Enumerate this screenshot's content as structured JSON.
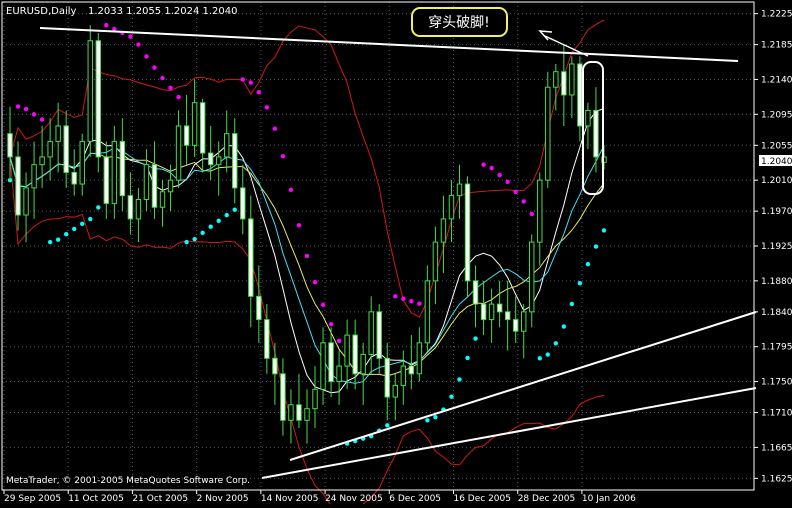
{
  "header": {
    "symbol": "EURUSD,Daily",
    "ohlc": "1.2033 1.2055 1.2024 1.2040"
  },
  "annotation": {
    "text": "穿头破脚!"
  },
  "copyright": "MetaTrader, © 2001-2005 MetaQuotes Software Corp.",
  "price_marker": "1.2040",
  "colors": {
    "background": "#000000",
    "grid": "#4a5a6a",
    "axis_text": "#ffffff",
    "candle_bull_fill": "#000000",
    "candle_bear_fill": "#ffffff",
    "candle_outline": "#44dd44",
    "bollinger": "#d01818",
    "ma_fast": "#ffffff",
    "ma_slow": "#e8e86a",
    "ma_cyan": "#40e0f0",
    "sar_magenta": "#ff00ff",
    "sar_cyan": "#00ffff",
    "callout_border": "#f0f060"
  },
  "chart_data": {
    "type": "candlestick",
    "title": "EURUSD,Daily",
    "ylim": [
      1.161,
      1.224
    ],
    "y_ticks": [
      "1.2225",
      "1.2185",
      "1.2140",
      "1.2095",
      "1.2055",
      "1.2010",
      "1.1970",
      "1.1925",
      "1.1880",
      "1.1840",
      "1.1795",
      "1.1750",
      "1.1710",
      "1.1665",
      "1.1625"
    ],
    "x_ticks": [
      "29 Sep 2005",
      "11 Oct 2005",
      "21 Oct 2005",
      "2 Nov 2005",
      "14 Nov 2005",
      "24 Nov 2005",
      "6 Dec 2005",
      "16 Dec 2005",
      "28 Dec 2005",
      "10 Jan 2006"
    ],
    "candles": [
      {
        "o": 1.207,
        "h": 1.2105,
        "l": 1.201,
        "c": 1.204
      },
      {
        "o": 1.204,
        "h": 1.206,
        "l": 1.1945,
        "c": 1.1965
      },
      {
        "o": 1.1965,
        "h": 1.202,
        "l": 1.193,
        "c": 1.2
      },
      {
        "o": 1.2,
        "h": 1.206,
        "l": 1.196,
        "c": 1.203
      },
      {
        "o": 1.203,
        "h": 1.208,
        "l": 1.2,
        "c": 1.204
      },
      {
        "o": 1.204,
        "h": 1.209,
        "l": 1.201,
        "c": 1.206
      },
      {
        "o": 1.206,
        "h": 1.211,
        "l": 1.202,
        "c": 1.208
      },
      {
        "o": 1.208,
        "h": 1.21,
        "l": 1.2,
        "c": 1.202
      },
      {
        "o": 1.202,
        "h": 1.205,
        "l": 1.199,
        "c": 1.2005
      },
      {
        "o": 1.2005,
        "h": 1.207,
        "l": 1.199,
        "c": 1.206
      },
      {
        "o": 1.206,
        "h": 1.221,
        "l": 1.204,
        "c": 1.219
      },
      {
        "o": 1.219,
        "h": 1.22,
        "l": 1.202,
        "c": 1.204
      },
      {
        "o": 1.204,
        "h": 1.206,
        "l": 1.196,
        "c": 1.198
      },
      {
        "o": 1.198,
        "h": 1.208,
        "l": 1.196,
        "c": 1.206
      },
      {
        "o": 1.206,
        "h": 1.209,
        "l": 1.197,
        "c": 1.199
      },
      {
        "o": 1.199,
        "h": 1.202,
        "l": 1.194,
        "c": 1.196
      },
      {
        "o": 1.196,
        "h": 1.2,
        "l": 1.193,
        "c": 1.1985
      },
      {
        "o": 1.1985,
        "h": 1.205,
        "l": 1.197,
        "c": 1.203
      },
      {
        "o": 1.203,
        "h": 1.206,
        "l": 1.196,
        "c": 1.1975
      },
      {
        "o": 1.1975,
        "h": 1.201,
        "l": 1.195,
        "c": 1.1995
      },
      {
        "o": 1.1995,
        "h": 1.203,
        "l": 1.197,
        "c": 1.201
      },
      {
        "o": 1.201,
        "h": 1.21,
        "l": 1.2,
        "c": 1.208
      },
      {
        "o": 1.208,
        "h": 1.212,
        "l": 1.203,
        "c": 1.2055
      },
      {
        "o": 1.2055,
        "h": 1.214,
        "l": 1.204,
        "c": 1.211
      },
      {
        "o": 1.211,
        "h": 1.2115,
        "l": 1.202,
        "c": 1.2045
      },
      {
        "o": 1.2045,
        "h": 1.208,
        "l": 1.201,
        "c": 1.203
      },
      {
        "o": 1.203,
        "h": 1.206,
        "l": 1.199,
        "c": 1.204
      },
      {
        "o": 1.204,
        "h": 1.21,
        "l": 1.202,
        "c": 1.207
      },
      {
        "o": 1.207,
        "h": 1.209,
        "l": 1.198,
        "c": 1.2
      },
      {
        "o": 1.2,
        "h": 1.203,
        "l": 1.194,
        "c": 1.196
      },
      {
        "o": 1.196,
        "h": 1.199,
        "l": 1.182,
        "c": 1.186
      },
      {
        "o": 1.186,
        "h": 1.19,
        "l": 1.18,
        "c": 1.183
      },
      {
        "o": 1.183,
        "h": 1.185,
        "l": 1.176,
        "c": 1.178
      },
      {
        "o": 1.178,
        "h": 1.18,
        "l": 1.172,
        "c": 1.176
      },
      {
        "o": 1.176,
        "h": 1.178,
        "l": 1.168,
        "c": 1.17
      },
      {
        "o": 1.17,
        "h": 1.174,
        "l": 1.167,
        "c": 1.172
      },
      {
        "o": 1.172,
        "h": 1.176,
        "l": 1.169,
        "c": 1.17
      },
      {
        "o": 1.17,
        "h": 1.174,
        "l": 1.167,
        "c": 1.1715
      },
      {
        "o": 1.1715,
        "h": 1.177,
        "l": 1.169,
        "c": 1.174
      },
      {
        "o": 1.174,
        "h": 1.182,
        "l": 1.172,
        "c": 1.18
      },
      {
        "o": 1.18,
        "h": 1.182,
        "l": 1.173,
        "c": 1.175
      },
      {
        "o": 1.175,
        "h": 1.179,
        "l": 1.172,
        "c": 1.177
      },
      {
        "o": 1.177,
        "h": 1.183,
        "l": 1.174,
        "c": 1.181
      },
      {
        "o": 1.181,
        "h": 1.183,
        "l": 1.174,
        "c": 1.176
      },
      {
        "o": 1.176,
        "h": 1.18,
        "l": 1.172,
        "c": 1.1785
      },
      {
        "o": 1.1785,
        "h": 1.186,
        "l": 1.176,
        "c": 1.184
      },
      {
        "o": 1.184,
        "h": 1.185,
        "l": 1.176,
        "c": 1.178
      },
      {
        "o": 1.178,
        "h": 1.18,
        "l": 1.17,
        "c": 1.173
      },
      {
        "o": 1.173,
        "h": 1.176,
        "l": 1.17,
        "c": 1.1745
      },
      {
        "o": 1.1745,
        "h": 1.179,
        "l": 1.172,
        "c": 1.177
      },
      {
        "o": 1.177,
        "h": 1.181,
        "l": 1.174,
        "c": 1.176
      },
      {
        "o": 1.176,
        "h": 1.182,
        "l": 1.175,
        "c": 1.18
      },
      {
        "o": 1.18,
        "h": 1.19,
        "l": 1.179,
        "c": 1.188
      },
      {
        "o": 1.188,
        "h": 1.195,
        "l": 1.185,
        "c": 1.193
      },
      {
        "o": 1.193,
        "h": 1.199,
        "l": 1.189,
        "c": 1.196
      },
      {
        "o": 1.196,
        "h": 1.201,
        "l": 1.193,
        "c": 1.199
      },
      {
        "o": 1.199,
        "h": 1.203,
        "l": 1.196,
        "c": 1.2005
      },
      {
        "o": 1.2005,
        "h": 1.2015,
        "l": 1.186,
        "c": 1.188
      },
      {
        "o": 1.188,
        "h": 1.19,
        "l": 1.182,
        "c": 1.185
      },
      {
        "o": 1.185,
        "h": 1.188,
        "l": 1.181,
        "c": 1.183
      },
      {
        "o": 1.183,
        "h": 1.187,
        "l": 1.18,
        "c": 1.185
      },
      {
        "o": 1.185,
        "h": 1.188,
        "l": 1.182,
        "c": 1.184
      },
      {
        "o": 1.184,
        "h": 1.188,
        "l": 1.179,
        "c": 1.183
      },
      {
        "o": 1.183,
        "h": 1.186,
        "l": 1.18,
        "c": 1.1815
      },
      {
        "o": 1.1815,
        "h": 1.185,
        "l": 1.178,
        "c": 1.184
      },
      {
        "o": 1.184,
        "h": 1.194,
        "l": 1.182,
        "c": 1.193
      },
      {
        "o": 1.193,
        "h": 1.202,
        "l": 1.19,
        "c": 1.201
      },
      {
        "o": 1.201,
        "h": 1.215,
        "l": 1.2,
        "c": 1.213
      },
      {
        "o": 1.213,
        "h": 1.216,
        "l": 1.21,
        "c": 1.215
      },
      {
        "o": 1.215,
        "h": 1.2185,
        "l": 1.208,
        "c": 1.212
      },
      {
        "o": 1.212,
        "h": 1.217,
        "l": 1.209,
        "c": 1.216
      },
      {
        "o": 1.216,
        "h": 1.217,
        "l": 1.206,
        "c": 1.208
      },
      {
        "o": 1.208,
        "h": 1.211,
        "l": 1.205,
        "c": 1.21
      },
      {
        "o": 1.21,
        "h": 1.213,
        "l": 1.202,
        "c": 1.204
      },
      {
        "o": 1.2033,
        "h": 1.2055,
        "l": 1.2024,
        "c": 1.204
      }
    ]
  }
}
